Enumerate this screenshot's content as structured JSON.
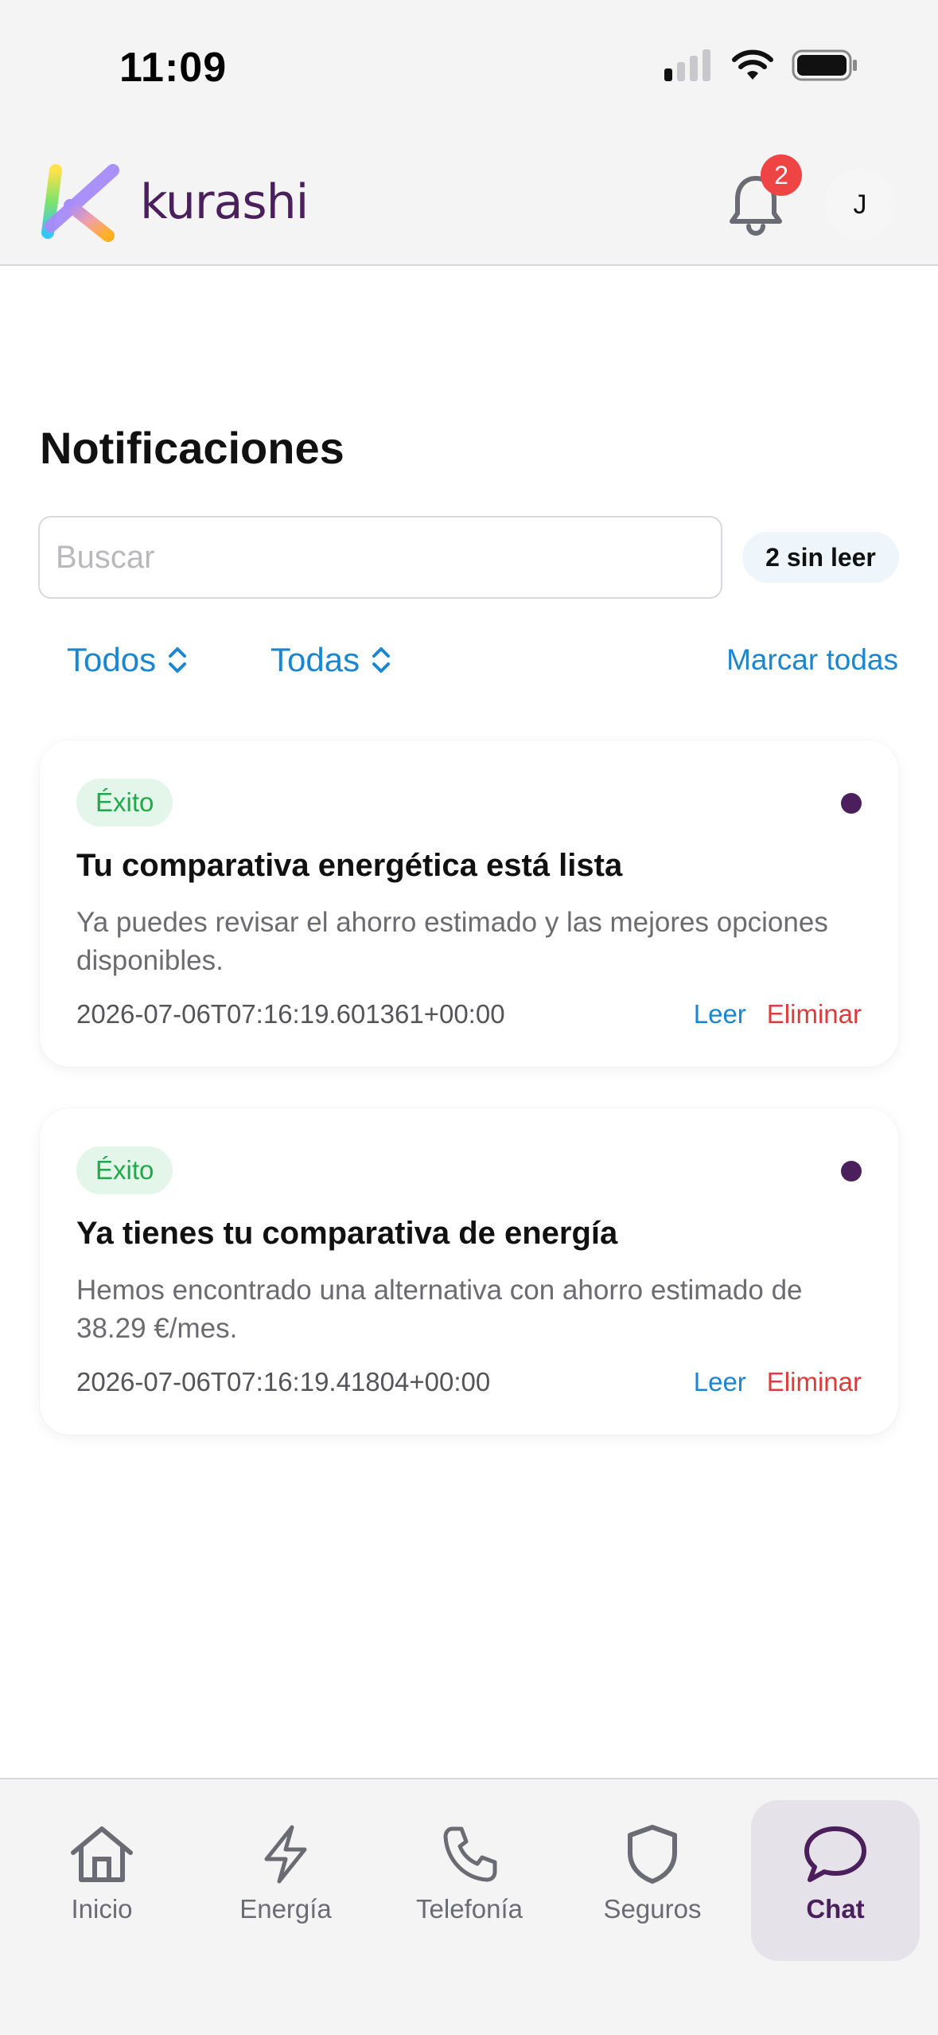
{
  "status_bar": {
    "time": "11:09"
  },
  "header": {
    "brand": "kurashi",
    "notification_count": "2",
    "avatar_initial": "J"
  },
  "page": {
    "title": "Notificaciones",
    "search_placeholder": "Buscar",
    "unread_badge": "2 sin leer",
    "filter_type": "Todos",
    "filter_category": "Todas",
    "mark_all": "Marcar todas"
  },
  "notifications": [
    {
      "tag": "Éxito",
      "title": "Tu comparativa energética está lista",
      "body": "Ya puedes revisar el ahorro estimado y las mejores opciones disponibles.",
      "timestamp": "2026-07-06T07:16:19.601361+00:00",
      "read_label": "Leer",
      "delete_label": "Eliminar"
    },
    {
      "tag": "Éxito",
      "title": "Ya tienes tu comparativa de energía",
      "body": "Hemos encontrado una alternativa con ahorro estimado de 38.29 €/mes.",
      "timestamp": "2026-07-06T07:16:19.41804+00:00",
      "read_label": "Leer",
      "delete_label": "Eliminar"
    }
  ],
  "nav": {
    "items": [
      {
        "label": "Inicio",
        "icon": "home-icon"
      },
      {
        "label": "Energía",
        "icon": "bolt-icon"
      },
      {
        "label": "Telefonía",
        "icon": "phone-icon"
      },
      {
        "label": "Seguros",
        "icon": "shield-icon"
      },
      {
        "label": "Chat",
        "icon": "chat-bubble-icon"
      }
    ],
    "active": "Chat"
  },
  "colors": {
    "accent": "#1a86d1",
    "brand": "#4a1f5c",
    "success": "#22a84b",
    "danger": "#dc3c3c",
    "badge": "#ef4444"
  }
}
